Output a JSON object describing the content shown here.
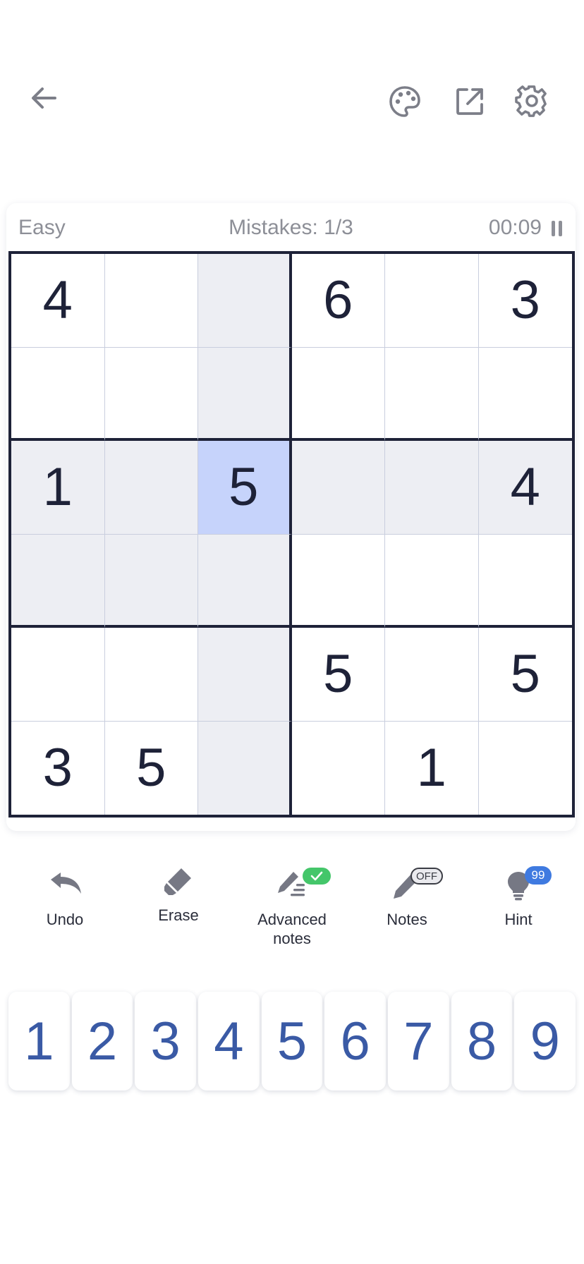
{
  "toolbar": {
    "back_icon": "arrow-left-icon",
    "theme_icon": "palette-icon",
    "export_icon": "external-link-icon",
    "settings_icon": "gear-icon"
  },
  "status": {
    "difficulty": "Easy",
    "mistakes": "Mistakes: 1/3",
    "timer": "00:09"
  },
  "board": {
    "size": 6,
    "selected": {
      "row": 2,
      "col": 2
    },
    "values": [
      [
        "4",
        "",
        "",
        "6",
        "",
        "3"
      ],
      [
        "",
        "",
        "",
        "",
        "",
        ""
      ],
      [
        "1",
        "",
        "5",
        "",
        "",
        "4"
      ],
      [
        "",
        "",
        "",
        "",
        "",
        ""
      ],
      [
        "",
        "",
        "",
        "5",
        "",
        "5"
      ],
      [
        "3",
        "5",
        "",
        "",
        "1",
        ""
      ]
    ]
  },
  "tools": {
    "undo": "Undo",
    "erase": "Erase",
    "advanced_notes": "Advanced notes",
    "advanced_notes_state": "on",
    "notes": "Notes",
    "notes_state": "OFF",
    "hint": "Hint",
    "hint_count": "99"
  },
  "numpad": [
    "1",
    "2",
    "3",
    "4",
    "5",
    "6",
    "7",
    "8",
    "9"
  ],
  "colors": {
    "accent": "#3a5aa5",
    "selected_cell": "#c6d3fb",
    "highlight": "#edeef3",
    "grid_line": "#1e2238",
    "success": "#44c66a",
    "badge_blue": "#3f7ae0"
  }
}
